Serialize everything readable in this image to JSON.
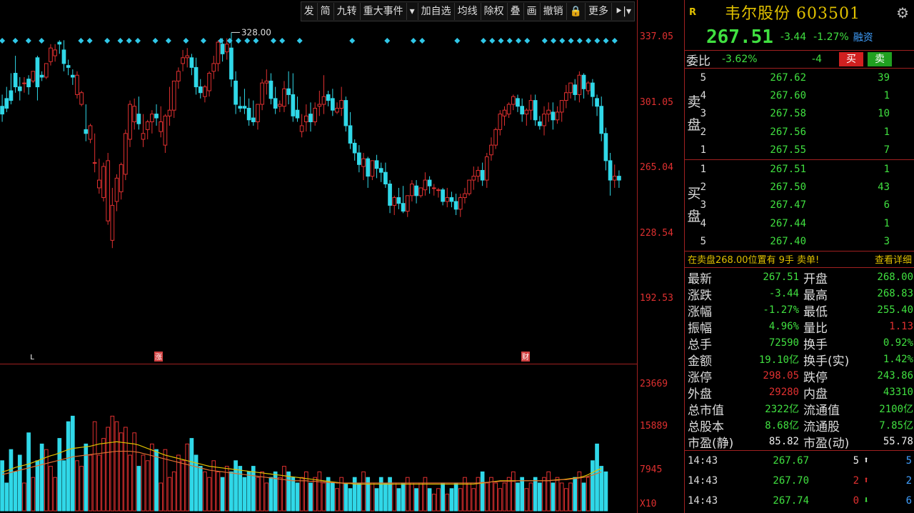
{
  "toolbar": [
    "发",
    "简",
    "九转",
    "重大事件",
    "▾",
    "加自选",
    "均线",
    "除权",
    "叠",
    "画",
    "撤销",
    "🔒",
    "更多",
    "⯈|▾"
  ],
  "price_axis": [
    "337.05",
    "301.05",
    "265.04",
    "228.54",
    "192.53"
  ],
  "vol_axis": [
    "23669",
    "15889",
    "7945",
    "X10"
  ],
  "high_marker": "328.00",
  "event_marks": {
    "l": "L",
    "z": "涨",
    "c": "财"
  },
  "colors": {
    "up": "#e03030",
    "down": "#30d8e8",
    "ma1": "#e0c000",
    "ma2": "#e07030",
    "bg": "#000000"
  },
  "chart_data": {
    "type": "candlestick",
    "ylim": [
      180,
      340
    ],
    "candles": [
      [
        300,
        306,
        296,
        292
      ],
      [
        304,
        310,
        299,
        297
      ],
      [
        308,
        317,
        303,
        301
      ],
      [
        317,
        326,
        310,
        307
      ],
      [
        310,
        315,
        308,
        303
      ],
      [
        312,
        315,
        312,
        307
      ],
      [
        314,
        316,
        310,
        306
      ],
      [
        313,
        318,
        318,
        312
      ],
      [
        325,
        326,
        310,
        303
      ],
      [
        316,
        318,
        315,
        313
      ],
      [
        315,
        320,
        322,
        314
      ],
      [
        323,
        332,
        330,
        321
      ],
      [
        326,
        332,
        329,
        323
      ],
      [
        333,
        334,
        332,
        327
      ],
      [
        329,
        334,
        322,
        318
      ],
      [
        321,
        324,
        320,
        316
      ],
      [
        316,
        319,
        315,
        311
      ],
      [
        306,
        318,
        316,
        304
      ],
      [
        301,
        308,
        307,
        300
      ],
      [
        288,
        301,
        286,
        282
      ],
      [
        283,
        291,
        290,
        281
      ],
      [
        271,
        286,
        271,
        266
      ],
      [
        258,
        273,
        262,
        255
      ],
      [
        253,
        271,
        269,
        251
      ],
      [
        241,
        276,
        272,
        239
      ],
      [
        231,
        258,
        249,
        227
      ],
      [
        251,
        265,
        263,
        246
      ],
      [
        256,
        271,
        270,
        252
      ],
      [
        265,
        288,
        286,
        262
      ],
      [
        283,
        303,
        301,
        279
      ],
      [
        292,
        304,
        300,
        288
      ],
      [
        296,
        305,
        291,
        288
      ],
      [
        283,
        296,
        286,
        279
      ],
      [
        288,
        293,
        292,
        283
      ],
      [
        292,
        298,
        296,
        286
      ],
      [
        296,
        301,
        294,
        290
      ],
      [
        287,
        300,
        292,
        284
      ],
      [
        280,
        296,
        295,
        276
      ],
      [
        295,
        310,
        298,
        290
      ],
      [
        298,
        311,
        313,
        294
      ],
      [
        313,
        320,
        318,
        309
      ],
      [
        322,
        329,
        325,
        318
      ],
      [
        325,
        330,
        326,
        320
      ],
      [
        325,
        327,
        320,
        316
      ],
      [
        320,
        325,
        310,
        306
      ],
      [
        310,
        314,
        307,
        304
      ],
      [
        305,
        311,
        310,
        302
      ],
      [
        308,
        318,
        317,
        305
      ],
      [
        318,
        326,
        322,
        314
      ],
      [
        322,
        334,
        333,
        318
      ],
      [
        332,
        335,
        327,
        323
      ],
      [
        328,
        335,
        332,
        324
      ],
      [
        330,
        338,
        314,
        310
      ],
      [
        313,
        318,
        301,
        296
      ],
      [
        300,
        305,
        299,
        297
      ],
      [
        300,
        309,
        299,
        296
      ],
      [
        299,
        304,
        293,
        290
      ],
      [
        294,
        303,
        292,
        290
      ],
      [
        292,
        300,
        301,
        288
      ],
      [
        301,
        314,
        312,
        298
      ],
      [
        312,
        319,
        313,
        306
      ],
      [
        313,
        317,
        304,
        301
      ],
      [
        304,
        310,
        299,
        296
      ],
      [
        300,
        303,
        301,
        297
      ],
      [
        300,
        313,
        309,
        297
      ],
      [
        309,
        318,
        306,
        301
      ],
      [
        306,
        317,
        295,
        292
      ],
      [
        298,
        305,
        294,
        292
      ],
      [
        287,
        296,
        290,
        284
      ],
      [
        292,
        301,
        295,
        287
      ],
      [
        296,
        302,
        292,
        287
      ],
      [
        292,
        302,
        299,
        290
      ],
      [
        300,
        308,
        301,
        295
      ],
      [
        301,
        316,
        305,
        296
      ],
      [
        306,
        308,
        303,
        300
      ],
      [
        304,
        309,
        298,
        295
      ],
      [
        297,
        302,
        299,
        296
      ],
      [
        299,
        310,
        303,
        295
      ],
      [
        303,
        305,
        290,
        287
      ],
      [
        290,
        297,
        281,
        278
      ],
      [
        281,
        283,
        276,
        272
      ],
      [
        276,
        280,
        270,
        266
      ],
      [
        269,
        276,
        273,
        262
      ],
      [
        273,
        274,
        264,
        258
      ],
      [
        264,
        266,
        272,
        262
      ],
      [
        272,
        275,
        268,
        263
      ],
      [
        268,
        271,
        266,
        261
      ],
      [
        266,
        271,
        260,
        258
      ],
      [
        260,
        262,
        249,
        245
      ],
      [
        249,
        254,
        253,
        244
      ],
      [
        253,
        258,
        250,
        247
      ],
      [
        250,
        259,
        246,
        245
      ],
      [
        246,
        252,
        254,
        243
      ],
      [
        254,
        262,
        260,
        251
      ],
      [
        259,
        262,
        254,
        250
      ],
      [
        254,
        258,
        258,
        253
      ],
      [
        257,
        266,
        262,
        254
      ],
      [
        262,
        264,
        259,
        255
      ],
      [
        258,
        260,
        258,
        254
      ],
      [
        257,
        258,
        257,
        253
      ],
      [
        257,
        258,
        251,
        249
      ],
      [
        251,
        258,
        253,
        248
      ],
      [
        253,
        256,
        251,
        248
      ],
      [
        251,
        255,
        247,
        244
      ],
      [
        247,
        255,
        253,
        243
      ],
      [
        253,
        258,
        255,
        250
      ],
      [
        255,
        258,
        262,
        254
      ],
      [
        262,
        269,
        264,
        257
      ],
      [
        264,
        269,
        267,
        261
      ],
      [
        267,
        271,
        262,
        259
      ],
      [
        262,
        276,
        274,
        258
      ],
      [
        275,
        284,
        280,
        272
      ],
      [
        280,
        289,
        288,
        278
      ],
      [
        288,
        298,
        296,
        285
      ],
      [
        295,
        300,
        298,
        290
      ],
      [
        296,
        302,
        301,
        294
      ],
      [
        301,
        306,
        305,
        298
      ],
      [
        304,
        306,
        300,
        297
      ],
      [
        300,
        304,
        296,
        292
      ],
      [
        296,
        299,
        298,
        290
      ],
      [
        298,
        306,
        303,
        293
      ],
      [
        303,
        306,
        293,
        290
      ],
      [
        292,
        295,
        290,
        288
      ],
      [
        290,
        300,
        296,
        285
      ],
      [
        296,
        302,
        298,
        292
      ],
      [
        297,
        302,
        293,
        288
      ],
      [
        293,
        300,
        297,
        291
      ],
      [
        297,
        303,
        303,
        292
      ],
      [
        303,
        311,
        307,
        299
      ],
      [
        307,
        312,
        312,
        304
      ],
      [
        311,
        314,
        306,
        303
      ],
      [
        306,
        318,
        316,
        302
      ],
      [
        316,
        317,
        309,
        304
      ],
      [
        308,
        313,
        312,
        306
      ],
      [
        312,
        314,
        305,
        300
      ],
      [
        304,
        306,
        300,
        295
      ],
      [
        300,
        305,
        286,
        282
      ],
      [
        286,
        289,
        272,
        267
      ],
      [
        272,
        276,
        262,
        254
      ],
      [
        262,
        270,
        264,
        258
      ],
      [
        264,
        267,
        262,
        258
      ]
    ],
    "volume": {
      "ylim": [
        0,
        25000
      ],
      "values": [
        9000,
        5000,
        11000,
        7000,
        10000,
        5000,
        14000,
        6000,
        9000,
        12000,
        11000,
        8000,
        6000,
        13000,
        9000,
        16000,
        17000,
        9000,
        8000,
        12000,
        10000,
        16000,
        10000,
        13000,
        15000,
        17000,
        16000,
        14000,
        15000,
        10000,
        14000,
        8000,
        10000,
        9000,
        12000,
        11000,
        5000,
        11000,
        6000,
        7000,
        10000,
        9000,
        12000,
        13000,
        10000,
        8000,
        7000,
        6000,
        9000,
        7000,
        6000,
        8000,
        7000,
        9000,
        8000,
        6000,
        7000,
        8000,
        6000,
        7000,
        5000,
        6000,
        7000,
        6000,
        8000,
        7000,
        6000,
        5000,
        6000,
        7000,
        5000,
        6000,
        7000,
        5000,
        6000,
        5000,
        4000,
        6000,
        5000,
        4000,
        6000,
        5000,
        7000,
        6000,
        5000,
        4000,
        6000,
        5000,
        6000,
        5000,
        4000,
        5000,
        6000,
        5000,
        4000,
        5000,
        6000,
        4000,
        3000,
        4000,
        5000,
        3000,
        4000,
        5000,
        4000,
        6000,
        5000,
        4000,
        6000,
        7000,
        5000,
        6000,
        5000,
        4000,
        5000,
        6000,
        7000,
        5000,
        6000,
        4000,
        5000,
        6000,
        5000,
        6000,
        7000,
        5000,
        6000,
        5000,
        4000,
        5000,
        6000,
        7000,
        5000,
        6000,
        9000,
        12000,
        8000,
        7000
      ],
      "ma1": [
        7000,
        7200,
        7500,
        7800,
        8000,
        8200,
        8400,
        8700,
        9000,
        9300,
        9600,
        9900,
        10100,
        10400,
        10700,
        11000,
        11200,
        11300,
        11400,
        11500,
        11600,
        11800,
        12000,
        12100,
        12200,
        12300,
        12400,
        12300,
        12200,
        12100,
        12000,
        11800,
        11500,
        11200,
        10900,
        10600,
        10300,
        10000,
        9800,
        9600,
        9400,
        9200,
        9000,
        8800,
        8600,
        8400,
        8200,
        8000,
        7900,
        7800,
        7700,
        7600,
        7500,
        7400,
        7300,
        7200,
        7100,
        7000,
        6900,
        6800,
        6700,
        6600,
        6500,
        6400,
        6300,
        6200,
        6100,
        6000,
        5900,
        5800,
        5700,
        5600,
        5500,
        5400,
        5300,
        5200,
        5100,
        5000,
        4900,
        4900,
        4800,
        4800,
        4800,
        4800,
        4800,
        4800,
        4800,
        4800,
        4800,
        4800,
        4800,
        4800,
        4800,
        4800,
        4800,
        4800,
        4800,
        4800,
        4800,
        4800,
        4800,
        4800,
        4800,
        4800,
        4800,
        4800,
        4800,
        4800,
        4900,
        5000,
        5100,
        5200,
        5300,
        5400,
        5400,
        5400,
        5400,
        5400,
        5400,
        5400,
        5400,
        5400,
        5400,
        5400,
        5400,
        5500,
        5600,
        5600,
        5700,
        5800,
        5900,
        6000,
        6200,
        6500,
        6900,
        7300,
        7600
      ],
      "ma2": [
        6500,
        6700,
        6900,
        7100,
        7300,
        7500,
        7700,
        7900,
        8100,
        8300,
        8500,
        8700,
        8900,
        9100,
        9300,
        9500,
        9700,
        9800,
        9900,
        10000,
        10100,
        10200,
        10300,
        10400,
        10500,
        10600,
        10700,
        10700,
        10700,
        10700,
        10600,
        10500,
        10300,
        10100,
        9900,
        9700,
        9500,
        9300,
        9100,
        8900,
        8700,
        8500,
        8300,
        8100,
        7900,
        7700,
        7500,
        7300,
        7200,
        7100,
        7000,
        6900,
        6800,
        6700,
        6600,
        6500,
        6400,
        6300,
        6200,
        6100,
        6000,
        5900,
        5800,
        5700,
        5600,
        5500,
        5400,
        5400,
        5400,
        5400,
        5300,
        5300,
        5200,
        5200,
        5100,
        5100,
        5000,
        5000,
        5000,
        5000,
        5000,
        5000,
        5000,
        5000,
        5000,
        5000,
        5000,
        5000,
        5000,
        5000,
        5000,
        5000,
        5000,
        5000,
        5000,
        5000,
        5000,
        5000,
        5000,
        5000,
        5000,
        5000,
        5000,
        5000,
        5000,
        5000,
        5000,
        5000,
        5000,
        5100,
        5100,
        5200,
        5200,
        5300,
        5300,
        5300,
        5300,
        5400,
        5400,
        5400,
        5400,
        5400,
        5400,
        5400,
        5400,
        5500,
        5500,
        5600,
        5600,
        5700,
        5800,
        5900,
        6000,
        6200,
        6400,
        6700,
        7000
      ]
    }
  },
  "panel": {
    "badge": "R",
    "title": "韦尔股份 603501",
    "gear": "⚙",
    "price": "267.51",
    "change": "-3.44",
    "change_pct": "-1.27%",
    "rz": "融资",
    "weibi_label": "委比",
    "weibi_pct": "-3.62%",
    "weibi_diff": "-4",
    "buy_btn": "买",
    "sell_btn": "卖",
    "sell_side_label": [
      "卖",
      "盘"
    ],
    "buy_side_label": [
      "买",
      "盘"
    ],
    "asks": [
      {
        "lvl": "5",
        "price": "267.62",
        "qty": "39"
      },
      {
        "lvl": "4",
        "price": "267.60",
        "qty": "1"
      },
      {
        "lvl": "3",
        "price": "267.58",
        "qty": "10"
      },
      {
        "lvl": "2",
        "price": "267.56",
        "qty": "1"
      },
      {
        "lvl": "1",
        "price": "267.55",
        "qty": "7"
      }
    ],
    "bids": [
      {
        "lvl": "1",
        "price": "267.51",
        "qty": "1"
      },
      {
        "lvl": "2",
        "price": "267.50",
        "qty": "43"
      },
      {
        "lvl": "3",
        "price": "267.47",
        "qty": "6"
      },
      {
        "lvl": "4",
        "price": "267.44",
        "qty": "1"
      },
      {
        "lvl": "5",
        "price": "267.40",
        "qty": "3"
      }
    ],
    "notice": "在卖盘268.00位置有 9手 卖单!",
    "notice_link": "查看详细",
    "stats": [
      [
        "最新",
        "267.51",
        "g",
        "开盘",
        "268.00",
        "g"
      ],
      [
        "涨跌",
        "-3.44",
        "g",
        "最高",
        "268.83",
        "g"
      ],
      [
        "涨幅",
        "-1.27%",
        "g",
        "最低",
        "255.40",
        "g"
      ],
      [
        "振幅",
        "4.96%",
        "g",
        "量比",
        "1.13",
        "r"
      ],
      [
        "总手",
        "72590",
        "g",
        "换手",
        "0.92%",
        "g"
      ],
      [
        "金额",
        "19.10亿",
        "g",
        "换手(实)",
        "1.42%",
        "g"
      ],
      [
        "涨停",
        "298.05",
        "r",
        "跌停",
        "243.86",
        "g"
      ],
      [
        "外盘",
        "29280",
        "r",
        "内盘",
        "43310",
        "g"
      ],
      [
        "总市值",
        "2322亿",
        "g",
        "流通值",
        "2100亿",
        "g"
      ],
      [
        "总股本",
        "8.68亿",
        "g",
        "流通股",
        "7.85亿",
        "g"
      ],
      [
        "市盈(静)",
        "85.82",
        "w",
        "市盈(动)",
        "55.78",
        "w"
      ]
    ],
    "ticks": [
      {
        "t": "14:43",
        "p": "267.67",
        "v": "5",
        "vc": "w",
        "a": "⬆",
        "ac": "w",
        "n": "5"
      },
      {
        "t": "14:43",
        "p": "267.70",
        "v": "2",
        "vc": "r",
        "a": "⬆",
        "ac": "r",
        "n": "2"
      },
      {
        "t": "14:43",
        "p": "267.74",
        "v": "0",
        "vc": "r",
        "a": "⬇",
        "ac": "g",
        "n": "6"
      }
    ]
  }
}
